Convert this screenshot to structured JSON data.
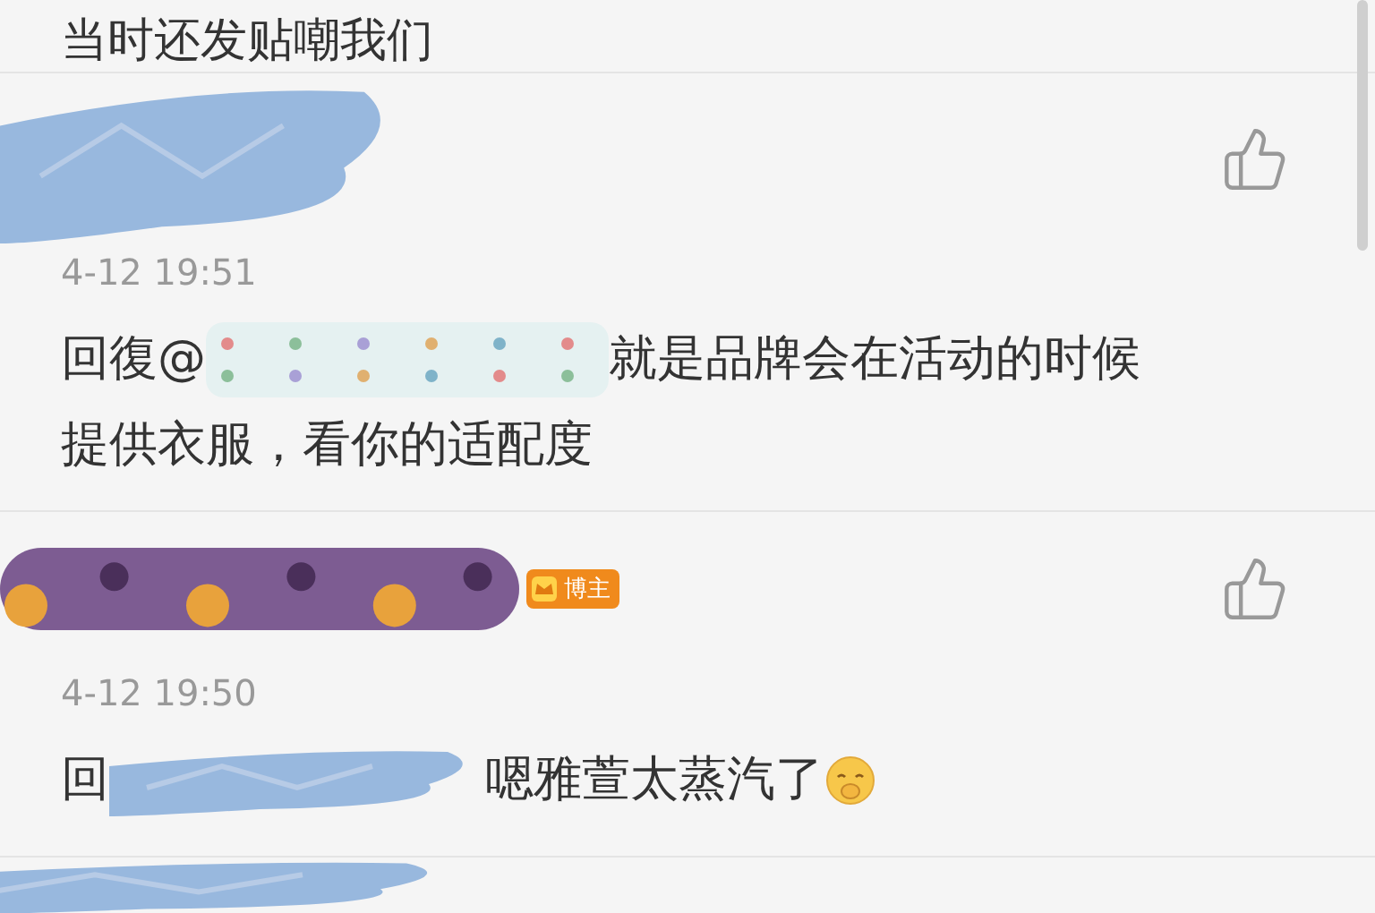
{
  "top_fragment": {
    "text": "当时还发贴嘲我们"
  },
  "comments": [
    {
      "kind": "scribbled",
      "time": "4-12 19:51",
      "reply_prefix": "回復@",
      "body_lines": [
        "就是品牌会在活动的时候",
        "提供衣服，看你的适配度"
      ],
      "emoji": false
    },
    {
      "kind": "patterned",
      "badge": "博主",
      "time": "4-12 19:50",
      "reply_prefix": "回",
      "body_lines": [
        "嗯雅萱太蒸汽了"
      ],
      "emoji": true
    }
  ]
}
